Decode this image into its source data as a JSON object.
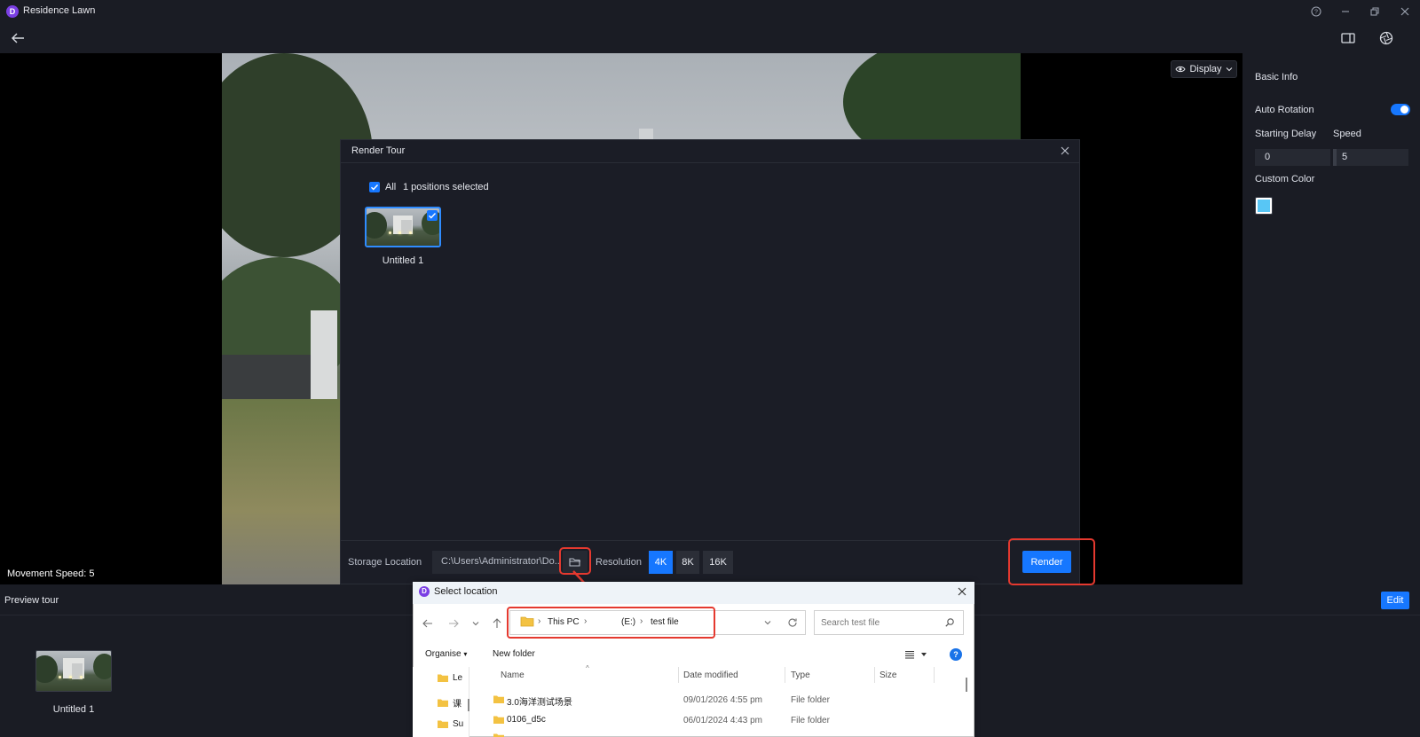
{
  "app": {
    "title": "Residence Lawn",
    "logo_letter": "D"
  },
  "viewer": {
    "display_label": "Display",
    "movement_speed": "Movement Speed: 5"
  },
  "right_panel": {
    "section_title": "Basic Info",
    "auto_rotation_label": "Auto Rotation",
    "auto_rotation_on": true,
    "starting_delay_label": "Starting Delay",
    "starting_delay_value": "0",
    "speed_label": "Speed",
    "speed_value": "5",
    "custom_color_label": "Custom Color",
    "custom_color": "#58c6f5"
  },
  "preview": {
    "title": "Preview tour",
    "edit_label": "Edit",
    "items": [
      {
        "label": "Untitled 1"
      }
    ]
  },
  "render_dialog": {
    "title": "Render Tour",
    "select_all_label": "All",
    "selection_count": "1 positions selected",
    "positions": [
      {
        "label": "Untitled 1",
        "selected": true
      }
    ],
    "storage_label": "Storage Location",
    "storage_path": "C:\\Users\\Administrator\\Do...",
    "resolution_label": "Resolution",
    "resolutions": [
      {
        "label": "4K",
        "active": true
      },
      {
        "label": "8K",
        "active": false
      },
      {
        "label": "16K",
        "active": false
      }
    ],
    "render_label": "Render"
  },
  "select_location": {
    "title": "Select location",
    "breadcrumb": [
      "This PC",
      "(E:)",
      "test file"
    ],
    "search_placeholder": "Search test file",
    "organise_label": "Organise",
    "new_folder_label": "New folder",
    "tree_items": [
      "Le",
      "课",
      "Su"
    ],
    "columns": [
      "Name",
      "Date modified",
      "Type",
      "Size"
    ],
    "rows": [
      {
        "name": "3.0海洋测试场景",
        "date": "09/01/2026 4:55 pm",
        "type": "File folder"
      },
      {
        "name": "0106_d5c",
        "date": "06/01/2024 4:43 pm",
        "type": "File folder"
      }
    ]
  },
  "colors": {
    "accent": "#1677ff",
    "highlight": "#e5392f"
  }
}
